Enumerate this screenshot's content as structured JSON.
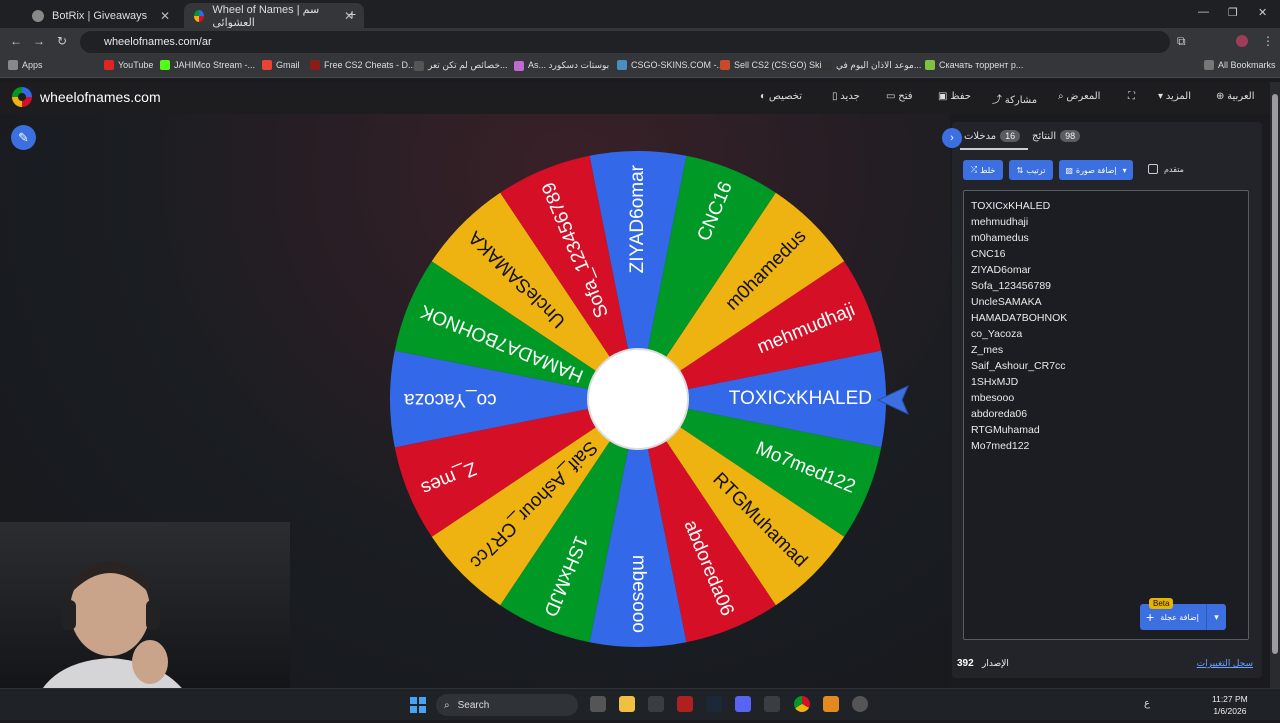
{
  "browser": {
    "tabs": [
      {
        "label": "BotRix | Giveaways",
        "active": false
      },
      {
        "label": "Wheel of Names | سم العشوائي",
        "active": true
      }
    ],
    "url": "wheelofnames.com/ar",
    "bookmarks": [
      "Apps",
      "YouTube",
      "JAHIMco Stream -...",
      "Gmail",
      "Free CS2 Cheats - D...",
      "خصائص لم تكن تعر...",
      "As... بوستات دسكورد",
      "CSGO-SKINS.COM -...",
      "Sell CS2 (CS:GO) Ski...",
      "موعد الاذان اليوم في...",
      "Скачать торрент p...",
      "All Bookmarks"
    ]
  },
  "app": {
    "brand": "wheelofnames.com",
    "menu": {
      "customize": "تخصيص",
      "new": "جديد",
      "open": "فتح",
      "save": "حفظ",
      "share": "مشاركة",
      "gallery": "المعرض",
      "more": "المزيد",
      "language": "العربية"
    }
  },
  "wheel": {
    "winner_pointer": "TOXICxKHALED",
    "colors": [
      "#3369e8",
      "#009925",
      "#eeb211",
      "#d50f25"
    ],
    "slices": [
      "TOXICxKHALED",
      "Mo7med122",
      "RTGMuhamad",
      "abdoreda06",
      "mbesooo",
      "1SHxMJD",
      "Saif_Ashour_CR7cc",
      "Z_mes",
      "co_Yacoza",
      "HAMADA7BOHNOK",
      "UncleSAMAKA",
      "Sofa_123456789",
      "ZIYAD6omar",
      "CNC16",
      "m0hamedus",
      "mehmudhaji"
    ]
  },
  "panel": {
    "tabs": {
      "entries_label": "مدخلات",
      "entries_count": "16",
      "results_label": "النتائج",
      "results_count": "98"
    },
    "buttons": {
      "shuffle": "خلط",
      "sort": "ترتيب",
      "add_image": "إضافة صورة",
      "advanced": "متقدم",
      "quick_add": "إضافة عجلة",
      "beta": "Beta"
    },
    "entries": [
      "TOXICxKHALED",
      "mehmudhaji",
      "m0hamedus",
      "CNC16",
      "ZIYAD6omar",
      "Sofa_123456789",
      "UncleSAMAKA",
      "HAMADA7BOHNOK",
      "co_Yacoza",
      "Z_mes",
      "Saif_Ashour_CR7cc",
      "1SHxMJD",
      "mbesooo",
      "abdoreda06",
      "RTGMuhamad",
      "Mo7med122"
    ],
    "version_label": "الإصدار",
    "version_number": "392",
    "changelog": "سجل التغييرات"
  },
  "taskbar": {
    "search_placeholder": "Search",
    "time": "11:27 PM",
    "date": "1/6/2026",
    "lang": "ع"
  }
}
